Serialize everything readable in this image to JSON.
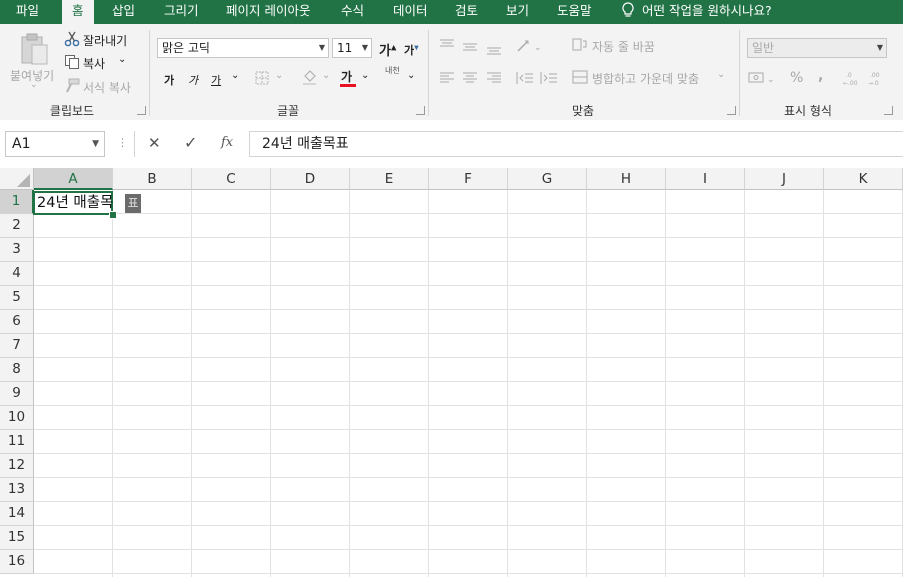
{
  "menu": {
    "tabs": [
      "파일",
      "홈",
      "삽입",
      "그리기",
      "페이지 레이아웃",
      "수식",
      "데이터",
      "검토",
      "보기",
      "도움말"
    ],
    "active_tab": "홈",
    "tell_me": "어떤 작업을 원하시나요?"
  },
  "ribbon": {
    "clipboard": {
      "paste": "붙여넣기",
      "cut": "잘라내기",
      "copy": "복사",
      "format_painter": "서식 복사",
      "label": "클립보드"
    },
    "font": {
      "font_name": "맑은 고딕",
      "font_size": "11",
      "grow": "가",
      "shrink": "가",
      "bold": "가",
      "italic": "가",
      "underline": "가",
      "font_color": "가",
      "phonetic": "내천",
      "label": "글꼴",
      "font_color_hex": "#e81123"
    },
    "alignment": {
      "wrap_text": "자동 줄 바꿈",
      "merge_center": "병합하고 가운데 맞춤",
      "label": "맞춤"
    },
    "number": {
      "format": "일반",
      "percent": "%",
      "comma": ",",
      "label": "표시 형식"
    }
  },
  "formula_bar": {
    "name_box": "A1",
    "cancel": "✕",
    "enter": "✓",
    "fx": "fx",
    "content": "24년 매출목표"
  },
  "sheet": {
    "columns": [
      "A",
      "B",
      "C",
      "D",
      "E",
      "F",
      "G",
      "H",
      "I",
      "J",
      "K"
    ],
    "rows": [
      "1",
      "2",
      "3",
      "4",
      "5",
      "6",
      "7",
      "8",
      "9",
      "10",
      "11",
      "12",
      "13",
      "14",
      "15",
      "16"
    ],
    "active_cell_text": "24년 매출목",
    "composing_char": "표"
  },
  "colors": {
    "accent": "#217346",
    "ribbon_bg": "#f3f3f3"
  }
}
